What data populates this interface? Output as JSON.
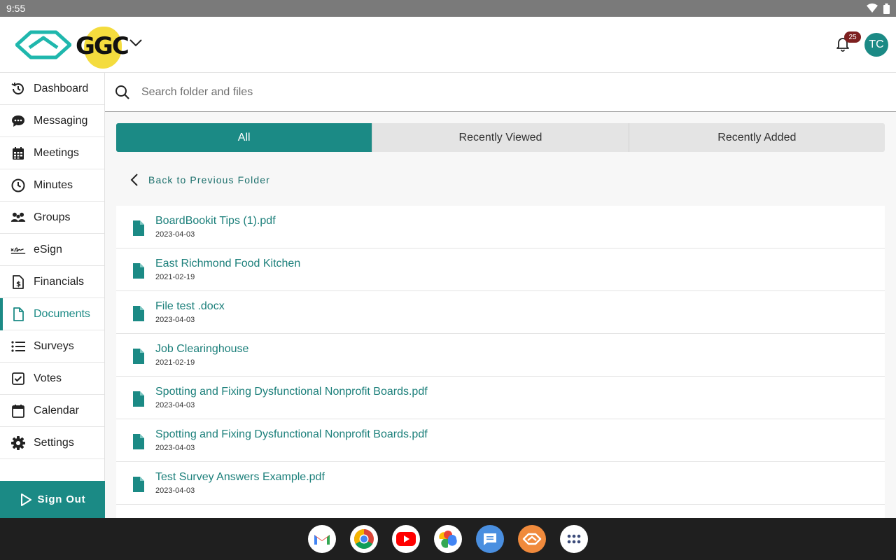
{
  "status_bar": {
    "time": "9:55"
  },
  "header": {
    "org_logo_text": "GGC",
    "notification_count": "25",
    "avatar_initials": "TC"
  },
  "sidebar": {
    "items": [
      {
        "label": "Dashboard",
        "icon": "history-icon"
      },
      {
        "label": "Messaging",
        "icon": "chat-icon"
      },
      {
        "label": "Meetings",
        "icon": "calendar-grid-icon"
      },
      {
        "label": "Minutes",
        "icon": "clock-icon"
      },
      {
        "label": "Groups",
        "icon": "people-icon"
      },
      {
        "label": "eSign",
        "icon": "signature-icon"
      },
      {
        "label": "Financials",
        "icon": "dollar-document-icon"
      },
      {
        "label": "Documents",
        "icon": "document-icon",
        "active": true
      },
      {
        "label": "Surveys",
        "icon": "list-icon"
      },
      {
        "label": "Votes",
        "icon": "checkbox-icon"
      },
      {
        "label": "Calendar",
        "icon": "calendar-icon"
      },
      {
        "label": "Settings",
        "icon": "gear-icon"
      }
    ],
    "sign_out": "Sign Out"
  },
  "search": {
    "placeholder": "Search folder and files"
  },
  "tabs": [
    "All",
    "Recently Viewed",
    "Recently Added"
  ],
  "back_label": "Back to Previous Folder",
  "files": [
    {
      "name": "BoardBookit Tips (1).pdf",
      "date": "2023-04-03"
    },
    {
      "name": "East Richmond Food Kitchen",
      "date": "2021-02-19"
    },
    {
      "name": "File test .docx",
      "date": "2023-04-03"
    },
    {
      "name": "Job Clearinghouse",
      "date": "2021-02-19"
    },
    {
      "name": "Spotting and Fixing Dysfunctional Nonprofit Boards.pdf",
      "date": "2023-04-03"
    },
    {
      "name": "Spotting and Fixing Dysfunctional Nonprofit Boards.pdf",
      "date": "2023-04-03"
    },
    {
      "name": "Test Survey Answers Example.pdf",
      "date": "2023-04-03"
    }
  ],
  "dock": [
    "gmail-icon",
    "chrome-icon",
    "youtube-icon",
    "photos-icon",
    "messages-icon",
    "boardbookit-icon",
    "app-drawer-icon"
  ],
  "colors": {
    "accent": "#1b8a85",
    "badge": "#7d1f1f",
    "org_logo_yellow": "#f4dc3e"
  }
}
